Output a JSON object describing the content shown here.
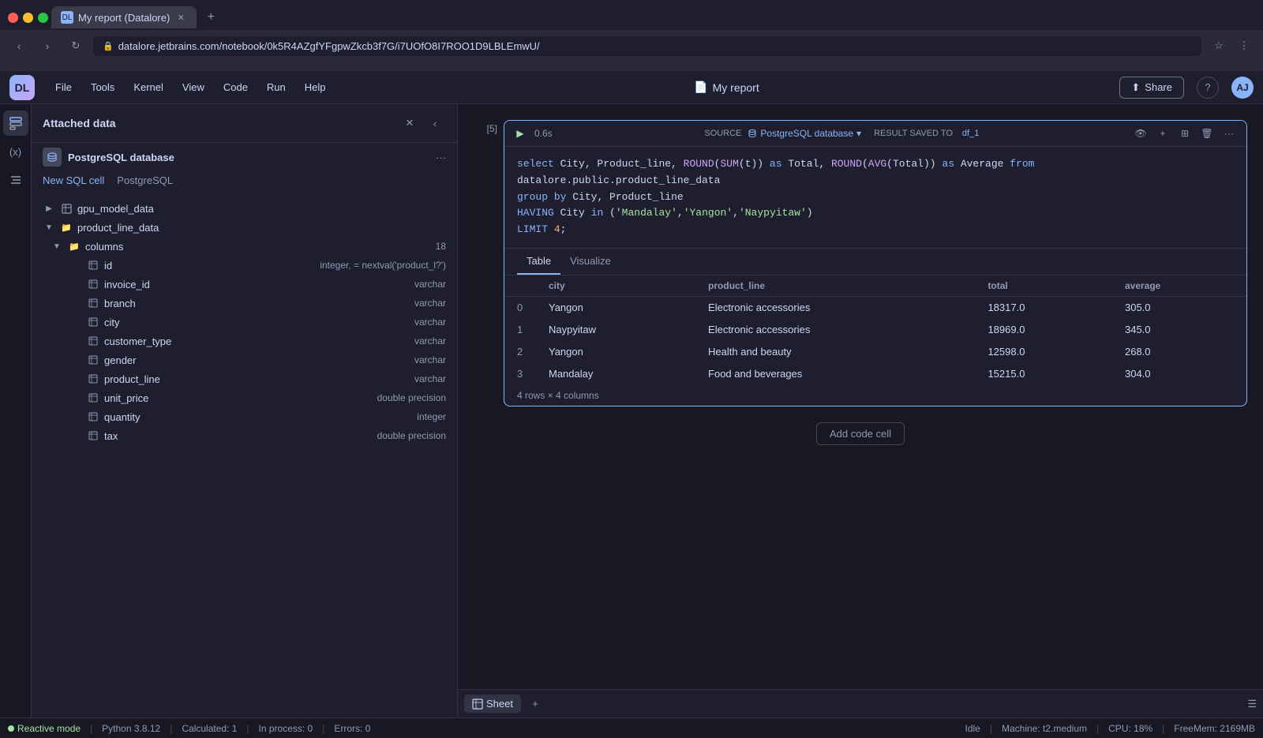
{
  "browser": {
    "tab_label": "My report (Datalore)",
    "url": "datalore.jetbrains.com/notebook/0k5R4AZgfYFgpwZkcb3f7G/i7UOfO8I7ROO1D9LBLEmwU/",
    "favicon": "DL"
  },
  "app": {
    "logo": "DL",
    "menu": [
      "File",
      "Tools",
      "Kernel",
      "View",
      "Code",
      "Run",
      "Help"
    ],
    "title": "My report",
    "title_icon": "📄",
    "share_label": "Share",
    "help_label": "?",
    "avatar_label": "AJ"
  },
  "data_panel": {
    "title": "Attached data",
    "tab_new_sql": "New SQL cell",
    "tab_postgresql": "PostgreSQL",
    "db_name": "PostgreSQL database",
    "tables": [
      {
        "name": "gpu_model_data",
        "expanded": false
      },
      {
        "name": "product_line_data",
        "expanded": true,
        "columns_count": 18,
        "columns": [
          {
            "name": "id",
            "type": "integer, = nextval('product_l?')"
          },
          {
            "name": "invoice_id",
            "type": "varchar"
          },
          {
            "name": "branch",
            "type": "varchar"
          },
          {
            "name": "city",
            "type": "varchar"
          },
          {
            "name": "customer_type",
            "type": "varchar"
          },
          {
            "name": "gender",
            "type": "varchar"
          },
          {
            "name": "product_line",
            "type": "varchar"
          },
          {
            "name": "unit_price",
            "type": "double precision"
          },
          {
            "name": "quantity",
            "type": "integer"
          },
          {
            "name": "tax",
            "type": "double precision"
          }
        ]
      }
    ]
  },
  "cell": {
    "number": "[5]",
    "time": "0.6s",
    "source_label": "SOURCE",
    "db_name": "PostgreSQL database",
    "result_label": "RESULT SAVED TO",
    "result_var": "df_1",
    "code_line1": "select City, Product_line, ROUND(SUM(t)) as Total, ROUND(AVG(Total)) as Average from",
    "code_line2": "datalore.public.product_line_data",
    "code_line3": "group by City, Product_line",
    "code_line4": "HAVING City in ('Mandalay','Yangon','Naypyitaw')",
    "code_line5": "LIMIT 4;"
  },
  "result_tabs": [
    "Table",
    "Visualize"
  ],
  "result_table": {
    "headers": [
      "",
      "city",
      "product_line",
      "total",
      "average"
    ],
    "rows": [
      {
        "index": "0",
        "city": "Yangon",
        "product_line": "Electronic accessories",
        "total": "18317.0",
        "average": "305.0"
      },
      {
        "index": "1",
        "city": "Naypyitaw",
        "product_line": "Electronic accessories",
        "total": "18969.0",
        "average": "345.0"
      },
      {
        "index": "2",
        "city": "Yangon",
        "product_line": "Health and beauty",
        "total": "12598.0",
        "average": "268.0"
      },
      {
        "index": "3",
        "city": "Mandalay",
        "product_line": "Food and beverages",
        "total": "15215.0",
        "average": "304.0"
      }
    ],
    "meta": "4 rows × 4 columns"
  },
  "add_cell_label": "Add code cell",
  "bottom_tabs": [
    {
      "label": "Sheet",
      "active": true
    }
  ],
  "add_sheet_label": "+",
  "status": {
    "reactive_mode": "Reactive mode",
    "python_version": "Python 3.8.12",
    "calculated": "Calculated: 1",
    "in_process": "In process: 0",
    "errors": "Errors: 0",
    "idle": "Idle",
    "machine": "Machine: t2.medium",
    "cpu": "CPU:  18%",
    "free_mem": "FreeMem: 2169MB"
  }
}
